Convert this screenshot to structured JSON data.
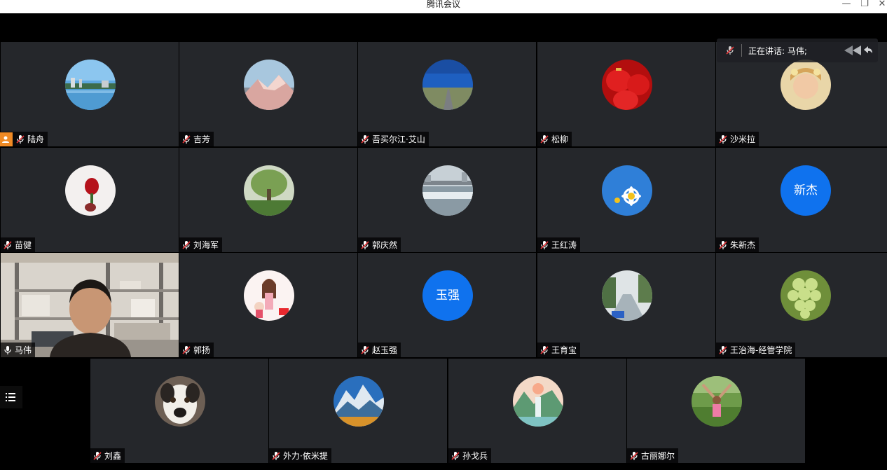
{
  "window": {
    "title": "腾讯会议",
    "minimize": "—",
    "restore": "❐",
    "close": "✕"
  },
  "speaking": {
    "label": "正在讲话: 马伟;"
  },
  "participants": [
    {
      "name": "陆舟",
      "avatar": "lake"
    },
    {
      "name": "吉芳",
      "avatar": "mountain-pink"
    },
    {
      "name": "吾买尔江·艾山",
      "avatar": "road-sky"
    },
    {
      "name": "松柳",
      "avatar": "red-lanterns"
    },
    {
      "name": "沙米拉",
      "avatar": "girl-portrait"
    },
    {
      "name": "苗健",
      "avatar": "rose"
    },
    {
      "name": "刘海军",
      "avatar": "willow-tree"
    },
    {
      "name": "郭庆然",
      "avatar": "river-city"
    },
    {
      "name": "王红涛",
      "avatar": "daisies"
    },
    {
      "name": "朱新杰",
      "avatar_text": "新杰"
    },
    {
      "name": "马伟",
      "avatar": "camera-video"
    },
    {
      "name": "郭扬",
      "avatar": "cartoon-girls"
    },
    {
      "name": "赵玉强",
      "avatar_text": "玉强"
    },
    {
      "name": "王育宝",
      "avatar": "road-trees"
    },
    {
      "name": "王治海-经管学院",
      "avatar": "grapes"
    },
    {
      "name": "刘鑫",
      "avatar": "dog"
    },
    {
      "name": "外力·依米提",
      "avatar": "mountain-autumn"
    },
    {
      "name": "孙戈兵",
      "avatar": "waterfall"
    },
    {
      "name": "古丽娜尔",
      "avatar": "woman-field"
    }
  ]
}
